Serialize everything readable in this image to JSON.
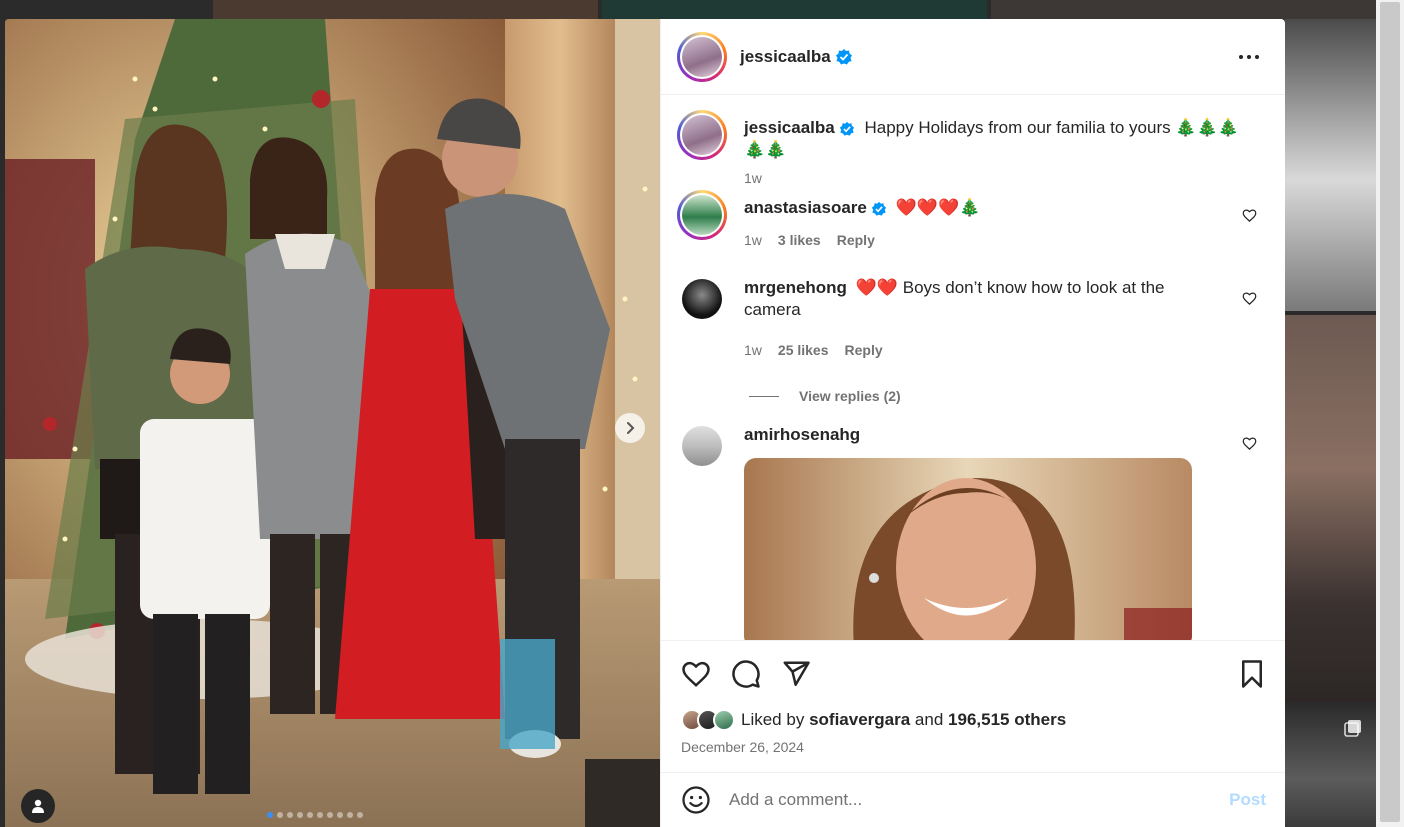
{
  "post": {
    "author": "jessicaalba",
    "caption": "Happy Holidays from our familia to yours 🎄🎄🎄🎄🎄",
    "caption_time": "1w",
    "date": "December 26, 2024",
    "liked_by_prefix": "Liked by",
    "liked_by_user": "sofiavergara",
    "liked_by_and": "and",
    "liked_by_others": "196,515 others",
    "carousel_count": 10,
    "carousel_active": 0
  },
  "comments": [
    {
      "user": "anastasiasoare",
      "verified": true,
      "text": "❤️❤️❤️🎄",
      "time": "1w",
      "likes": "3 likes",
      "reply": "Reply"
    },
    {
      "user": "mrgenehong",
      "verified": false,
      "text": "❤️❤️ Boys don’t know how to look at the camera",
      "time": "1w",
      "likes": "25 likes",
      "reply": "Reply",
      "view_replies": "View replies (2)"
    },
    {
      "user": "amirhosenahg",
      "verified": false,
      "text": ""
    }
  ],
  "add_comment": {
    "placeholder": "Add a comment...",
    "post_label": "Post"
  },
  "icons": [
    "verified-badge-icon",
    "more-options-icon",
    "heart-icon",
    "comment-icon",
    "share-icon",
    "bookmark-icon",
    "emoji-icon",
    "chevron-right-icon",
    "user-tag-icon"
  ],
  "colors": {
    "verified": "#0095f6",
    "muted": "#737373",
    "text": "#262626",
    "post_disabled": "#b3dbff"
  }
}
